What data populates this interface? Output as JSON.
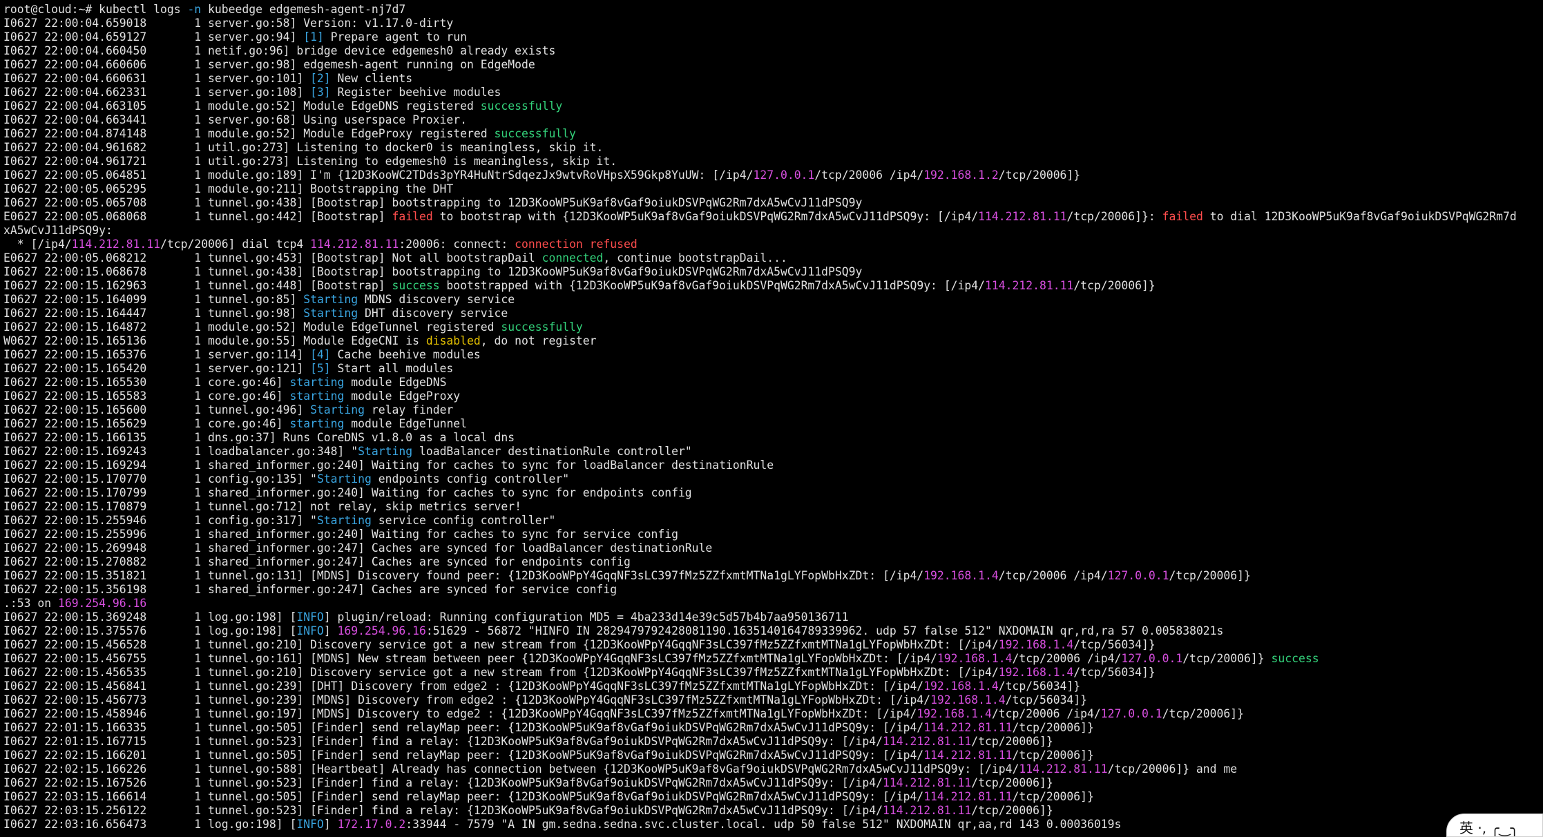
{
  "colors": {
    "w": "#e0e0e0",
    "cyan": "#3aa6e2",
    "green": "#33d17a",
    "magenta": "#d84fe0",
    "red": "#ff4d4d",
    "yellow": "#e5c100",
    "background": "#000000"
  },
  "terminal": {
    "lines": [
      [
        [
          "w",
          "root@cloud:~# kubectl logs "
        ],
        [
          "cyan",
          "-n"
        ],
        [
          "w",
          " kubeedge edgemesh-agent-nj7d7"
        ]
      ],
      [
        [
          "w",
          "I0627 22:00:04.659018       1 server.go:58] Version: v1.17.0-dirty"
        ]
      ],
      [
        [
          "w",
          "I0627 22:00:04.659127       1 server.go:94] "
        ],
        [
          "cyan",
          "[1]"
        ],
        [
          "w",
          " Prepare agent to run"
        ]
      ],
      [
        [
          "w",
          "I0627 22:00:04.660450       1 netif.go:96] bridge device edgemesh0 already exists"
        ]
      ],
      [
        [
          "w",
          "I0627 22:00:04.660606       1 server.go:98] edgemesh-agent running on EdgeMode"
        ]
      ],
      [
        [
          "w",
          "I0627 22:00:04.660631       1 server.go:101] "
        ],
        [
          "cyan",
          "[2]"
        ],
        [
          "w",
          " New clients"
        ]
      ],
      [
        [
          "w",
          "I0627 22:00:04.662331       1 server.go:108] "
        ],
        [
          "cyan",
          "[3]"
        ],
        [
          "w",
          " Register beehive modules"
        ]
      ],
      [
        [
          "w",
          "I0627 22:00:04.663105       1 module.go:52] Module EdgeDNS registered "
        ],
        [
          "green",
          "successfully"
        ]
      ],
      [
        [
          "w",
          "I0627 22:00:04.663441       1 server.go:68] Using userspace Proxier."
        ]
      ],
      [
        [
          "w",
          "I0627 22:00:04.874148       1 module.go:52] Module EdgeProxy registered "
        ],
        [
          "green",
          "successfully"
        ]
      ],
      [
        [
          "w",
          "I0627 22:00:04.961682       1 util.go:273] Listening to docker0 is meaningless, skip it."
        ]
      ],
      [
        [
          "w",
          "I0627 22:00:04.961721       1 util.go:273] Listening to edgemesh0 is meaningless, skip it."
        ]
      ],
      [
        [
          "w",
          "I0627 22:00:05.064851       1 module.go:189] I'm {12D3KooWC2TDds3pYR4HuNtrSdqezJx9wtvRoVHpsX59Gkp8YuUW: [/ip4/"
        ],
        [
          "magenta",
          "127.0.0.1"
        ],
        [
          "w",
          "/tcp/20006 /ip4/"
        ],
        [
          "magenta",
          "192.168.1.2"
        ],
        [
          "w",
          "/tcp/20006]}"
        ]
      ],
      [
        [
          "w",
          "I0627 22:00:05.065295       1 module.go:211] Bootstrapping the DHT"
        ]
      ],
      [
        [
          "w",
          "I0627 22:00:05.065708       1 tunnel.go:438] [Bootstrap] bootstrapping to 12D3KooWP5uK9af8vGaf9oiukDSVPqWG2Rm7dxA5wCvJ11dPSQ9y"
        ]
      ],
      [
        [
          "w",
          "E0627 22:00:05.068068       1 tunnel.go:442] [Bootstrap] "
        ],
        [
          "red",
          "failed"
        ],
        [
          "w",
          " to bootstrap with {12D3KooWP5uK9af8vGaf9oiukDSVPqWG2Rm7dxA5wCvJ11dPSQ9y: [/ip4/"
        ],
        [
          "magenta",
          "114.212.81.11"
        ],
        [
          "w",
          "/tcp/20006]}: "
        ],
        [
          "red",
          "failed"
        ],
        [
          "w",
          " to dial 12D3KooWP5uK9af8vGaf9oiukDSVPqWG2Rm7d"
        ]
      ],
      [
        [
          "w",
          "xA5wCvJ11dPSQ9y:"
        ]
      ],
      [
        [
          "w",
          "  * [/ip4/"
        ],
        [
          "magenta",
          "114.212.81.11"
        ],
        [
          "w",
          "/tcp/20006] dial tcp4 "
        ],
        [
          "magenta",
          "114.212.81.11"
        ],
        [
          "w",
          ":20006: connect: "
        ],
        [
          "red",
          "connection refused"
        ]
      ],
      [
        [
          "w",
          "E0627 22:00:05.068212       1 tunnel.go:453] [Bootstrap] Not all bootstrapDail "
        ],
        [
          "green",
          "connected"
        ],
        [
          "w",
          ", continue bootstrapDail..."
        ]
      ],
      [
        [
          "w",
          "I0627 22:00:15.068678       1 tunnel.go:438] [Bootstrap] bootstrapping to 12D3KooWP5uK9af8vGaf9oiukDSVPqWG2Rm7dxA5wCvJ11dPSQ9y"
        ]
      ],
      [
        [
          "w",
          "I0627 22:00:15.162963       1 tunnel.go:448] [Bootstrap] "
        ],
        [
          "green",
          "success"
        ],
        [
          "w",
          " bootstrapped with {12D3KooWP5uK9af8vGaf9oiukDSVPqWG2Rm7dxA5wCvJ11dPSQ9y: [/ip4/"
        ],
        [
          "magenta",
          "114.212.81.11"
        ],
        [
          "w",
          "/tcp/20006]}"
        ]
      ],
      [
        [
          "w",
          "I0627 22:00:15.164099       1 tunnel.go:85] "
        ],
        [
          "cyan",
          "Starting"
        ],
        [
          "w",
          " MDNS discovery service"
        ]
      ],
      [
        [
          "w",
          "I0627 22:00:15.164447       1 tunnel.go:98] "
        ],
        [
          "cyan",
          "Starting"
        ],
        [
          "w",
          " DHT discovery service"
        ]
      ],
      [
        [
          "w",
          "I0627 22:00:15.164872       1 module.go:52] Module EdgeTunnel registered "
        ],
        [
          "green",
          "successfully"
        ]
      ],
      [
        [
          "w",
          "W0627 22:00:15.165136       1 module.go:55] Module EdgeCNI is "
        ],
        [
          "yellow",
          "disabled"
        ],
        [
          "w",
          ", do not register"
        ]
      ],
      [
        [
          "w",
          "I0627 22:00:15.165376       1 server.go:114] "
        ],
        [
          "cyan",
          "[4]"
        ],
        [
          "w",
          " Cache beehive modules"
        ]
      ],
      [
        [
          "w",
          "I0627 22:00:15.165420       1 server.go:121] "
        ],
        [
          "cyan",
          "[5]"
        ],
        [
          "w",
          " Start all modules"
        ]
      ],
      [
        [
          "w",
          "I0627 22:00:15.165530       1 core.go:46] "
        ],
        [
          "cyan",
          "starting"
        ],
        [
          "w",
          " module EdgeDNS"
        ]
      ],
      [
        [
          "w",
          "I0627 22:00:15.165583       1 core.go:46] "
        ],
        [
          "cyan",
          "starting"
        ],
        [
          "w",
          " module EdgeProxy"
        ]
      ],
      [
        [
          "w",
          "I0627 22:00:15.165600       1 tunnel.go:496] "
        ],
        [
          "cyan",
          "Starting"
        ],
        [
          "w",
          " relay finder"
        ]
      ],
      [
        [
          "w",
          "I0627 22:00:15.165629       1 core.go:46] "
        ],
        [
          "cyan",
          "starting"
        ],
        [
          "w",
          " module EdgeTunnel"
        ]
      ],
      [
        [
          "w",
          "I0627 22:00:15.166135       1 dns.go:37] Runs CoreDNS v1.8.0 as a local dns"
        ]
      ],
      [
        [
          "w",
          "I0627 22:00:15.169243       1 loadbalancer.go:348] \""
        ],
        [
          "cyan",
          "Starting"
        ],
        [
          "w",
          " loadBalancer destinationRule controller\""
        ]
      ],
      [
        [
          "w",
          "I0627 22:00:15.169294       1 shared_informer.go:240] Waiting for caches to sync for loadBalancer destinationRule"
        ]
      ],
      [
        [
          "w",
          "I0627 22:00:15.170770       1 config.go:135] \""
        ],
        [
          "cyan",
          "Starting"
        ],
        [
          "w",
          " endpoints config controller\""
        ]
      ],
      [
        [
          "w",
          "I0627 22:00:15.170799       1 shared_informer.go:240] Waiting for caches to sync for endpoints config"
        ]
      ],
      [
        [
          "w",
          "I0627 22:00:15.170879       1 tunnel.go:712] not relay, skip metrics server!"
        ]
      ],
      [
        [
          "w",
          "I0627 22:00:15.255946       1 config.go:317] \""
        ],
        [
          "cyan",
          "Starting"
        ],
        [
          "w",
          " service config controller\""
        ]
      ],
      [
        [
          "w",
          "I0627 22:00:15.255996       1 shared_informer.go:240] Waiting for caches to sync for service config"
        ]
      ],
      [
        [
          "w",
          "I0627 22:00:15.269948       1 shared_informer.go:247] Caches are synced for loadBalancer destinationRule"
        ]
      ],
      [
        [
          "w",
          "I0627 22:00:15.270882       1 shared_informer.go:247] Caches are synced for endpoints config"
        ]
      ],
      [
        [
          "w",
          "I0627 22:00:15.351821       1 tunnel.go:131] [MDNS] Discovery found peer: {12D3KooWPpY4GqqNF3sLC397fMz5ZZfxmtMTNa1gLYFopWbHxZDt: [/ip4/"
        ],
        [
          "magenta",
          "192.168.1.4"
        ],
        [
          "w",
          "/tcp/20006 /ip4/"
        ],
        [
          "magenta",
          "127.0.0.1"
        ],
        [
          "w",
          "/tcp/20006]}"
        ]
      ],
      [
        [
          "w",
          "I0627 22:00:15.356198       1 shared_informer.go:247] Caches are synced for service config"
        ]
      ],
      [
        [
          "w",
          ".:53 on "
        ],
        [
          "magenta",
          "169.254.96.16"
        ]
      ],
      [
        [
          "w",
          "I0627 22:00:15.369248       1 log.go:198] ["
        ],
        [
          "cyan",
          "INFO"
        ],
        [
          "w",
          "] plugin/reload: Running configuration MD5 = 4ba233d14e39c5d57b4b7aa950136711"
        ]
      ],
      [
        [
          "w",
          "I0627 22:00:15.375576       1 log.go:198] ["
        ],
        [
          "cyan",
          "INFO"
        ],
        [
          "w",
          "] "
        ],
        [
          "magenta",
          "169.254.96.16"
        ],
        [
          "w",
          ":51629 - 56872 \"HINFO IN 2829479792428081190.1635140164789339962. udp 57 false 512\" NXDOMAIN qr,rd,ra 57 0.005838021s"
        ]
      ],
      [
        [
          "w",
          "I0627 22:00:15.456528       1 tunnel.go:210] Discovery service got a new stream from {12D3KooWPpY4GqqNF3sLC397fMz5ZZfxmtMTNa1gLYFopWbHxZDt: [/ip4/"
        ],
        [
          "magenta",
          "192.168.1.4"
        ],
        [
          "w",
          "/tcp/56034]}"
        ]
      ],
      [
        [
          "w",
          "I0627 22:00:15.456755       1 tunnel.go:161] [MDNS] New stream between peer {12D3KooWPpY4GqqNF3sLC397fMz5ZZfxmtMTNa1gLYFopWbHxZDt: [/ip4/"
        ],
        [
          "magenta",
          "192.168.1.4"
        ],
        [
          "w",
          "/tcp/20006 /ip4/"
        ],
        [
          "magenta",
          "127.0.0.1"
        ],
        [
          "w",
          "/tcp/20006]} "
        ],
        [
          "green",
          "success"
        ]
      ],
      [
        [
          "w",
          "I0627 22:00:15.456535       1 tunnel.go:210] Discovery service got a new stream from {12D3KooWPpY4GqqNF3sLC397fMz5ZZfxmtMTNa1gLYFopWbHxZDt: [/ip4/"
        ],
        [
          "magenta",
          "192.168.1.4"
        ],
        [
          "w",
          "/tcp/56034]}"
        ]
      ],
      [
        [
          "w",
          "I0627 22:00:15.456841       1 tunnel.go:239] [DHT] Discovery from edge2 : {12D3KooWPpY4GqqNF3sLC397fMz5ZZfxmtMTNa1gLYFopWbHxZDt: [/ip4/"
        ],
        [
          "magenta",
          "192.168.1.4"
        ],
        [
          "w",
          "/tcp/56034]}"
        ]
      ],
      [
        [
          "w",
          "I0627 22:00:15.456773       1 tunnel.go:239] [MDNS] Discovery from edge2 : {12D3KooWPpY4GqqNF3sLC397fMz5ZZfxmtMTNa1gLYFopWbHxZDt: [/ip4/"
        ],
        [
          "magenta",
          "192.168.1.4"
        ],
        [
          "w",
          "/tcp/56034]}"
        ]
      ],
      [
        [
          "w",
          "I0627 22:00:15.458946       1 tunnel.go:197] [MDNS] Discovery to edge2 : {12D3KooWPpY4GqqNF3sLC397fMz5ZZfxmtMTNa1gLYFopWbHxZDt: [/ip4/"
        ],
        [
          "magenta",
          "192.168.1.4"
        ],
        [
          "w",
          "/tcp/20006 /ip4/"
        ],
        [
          "magenta",
          "127.0.0.1"
        ],
        [
          "w",
          "/tcp/20006]}"
        ]
      ],
      [
        [
          "w",
          "I0627 22:01:15.166335       1 tunnel.go:505] [Finder] send relayMap peer: {12D3KooWP5uK9af8vGaf9oiukDSVPqWG2Rm7dxA5wCvJ11dPSQ9y: [/ip4/"
        ],
        [
          "magenta",
          "114.212.81.11"
        ],
        [
          "w",
          "/tcp/20006]}"
        ]
      ],
      [
        [
          "w",
          "I0627 22:01:15.167715       1 tunnel.go:523] [Finder] find a relay: {12D3KooWP5uK9af8vGaf9oiukDSVPqWG2Rm7dxA5wCvJ11dPSQ9y: [/ip4/"
        ],
        [
          "magenta",
          "114.212.81.11"
        ],
        [
          "w",
          "/tcp/20006]}"
        ]
      ],
      [
        [
          "w",
          "I0627 22:02:15.166201       1 tunnel.go:505] [Finder] send relayMap peer: {12D3KooWP5uK9af8vGaf9oiukDSVPqWG2Rm7dxA5wCvJ11dPSQ9y: [/ip4/"
        ],
        [
          "magenta",
          "114.212.81.11"
        ],
        [
          "w",
          "/tcp/20006]}"
        ]
      ],
      [
        [
          "w",
          "I0627 22:02:15.166226       1 tunnel.go:588] [Heartbeat] Already has connection between {12D3KooWP5uK9af8vGaf9oiukDSVPqWG2Rm7dxA5wCvJ11dPSQ9y: [/ip4/"
        ],
        [
          "magenta",
          "114.212.81.11"
        ],
        [
          "w",
          "/tcp/20006]} and me"
        ]
      ],
      [
        [
          "w",
          "I0627 22:02:15.167526       1 tunnel.go:523] [Finder] find a relay: {12D3KooWP5uK9af8vGaf9oiukDSVPqWG2Rm7dxA5wCvJ11dPSQ9y: [/ip4/"
        ],
        [
          "magenta",
          "114.212.81.11"
        ],
        [
          "w",
          "/tcp/20006]}"
        ]
      ],
      [
        [
          "w",
          "I0627 22:03:15.166614       1 tunnel.go:505] [Finder] send relayMap peer: {12D3KooWP5uK9af8vGaf9oiukDSVPqWG2Rm7dxA5wCvJ11dPSQ9y: [/ip4/"
        ],
        [
          "magenta",
          "114.212.81.11"
        ],
        [
          "w",
          "/tcp/20006]}"
        ]
      ],
      [
        [
          "w",
          "I0627 22:03:15.256122       1 tunnel.go:523] [Finder] find a relay: {12D3KooWP5uK9af8vGaf9oiukDSVPqWG2Rm7dxA5wCvJ11dPSQ9y: [/ip4/"
        ],
        [
          "magenta",
          "114.212.81.11"
        ],
        [
          "w",
          "/tcp/20006]}"
        ]
      ],
      [
        [
          "w",
          "I0627 22:03:16.656473       1 log.go:198] ["
        ],
        [
          "cyan",
          "INFO"
        ],
        [
          "w",
          "] "
        ],
        [
          "magenta",
          "172.17.0.2"
        ],
        [
          "w",
          ":33944 - 7579 \"A IN gm.sedna.sedna.svc.cluster.local. udp 50 false 512\" NXDOMAIN qr,aa,rd 143 0.00036019s"
        ]
      ]
    ]
  },
  "ime": {
    "label": "英 ·, ╭‿╮"
  }
}
